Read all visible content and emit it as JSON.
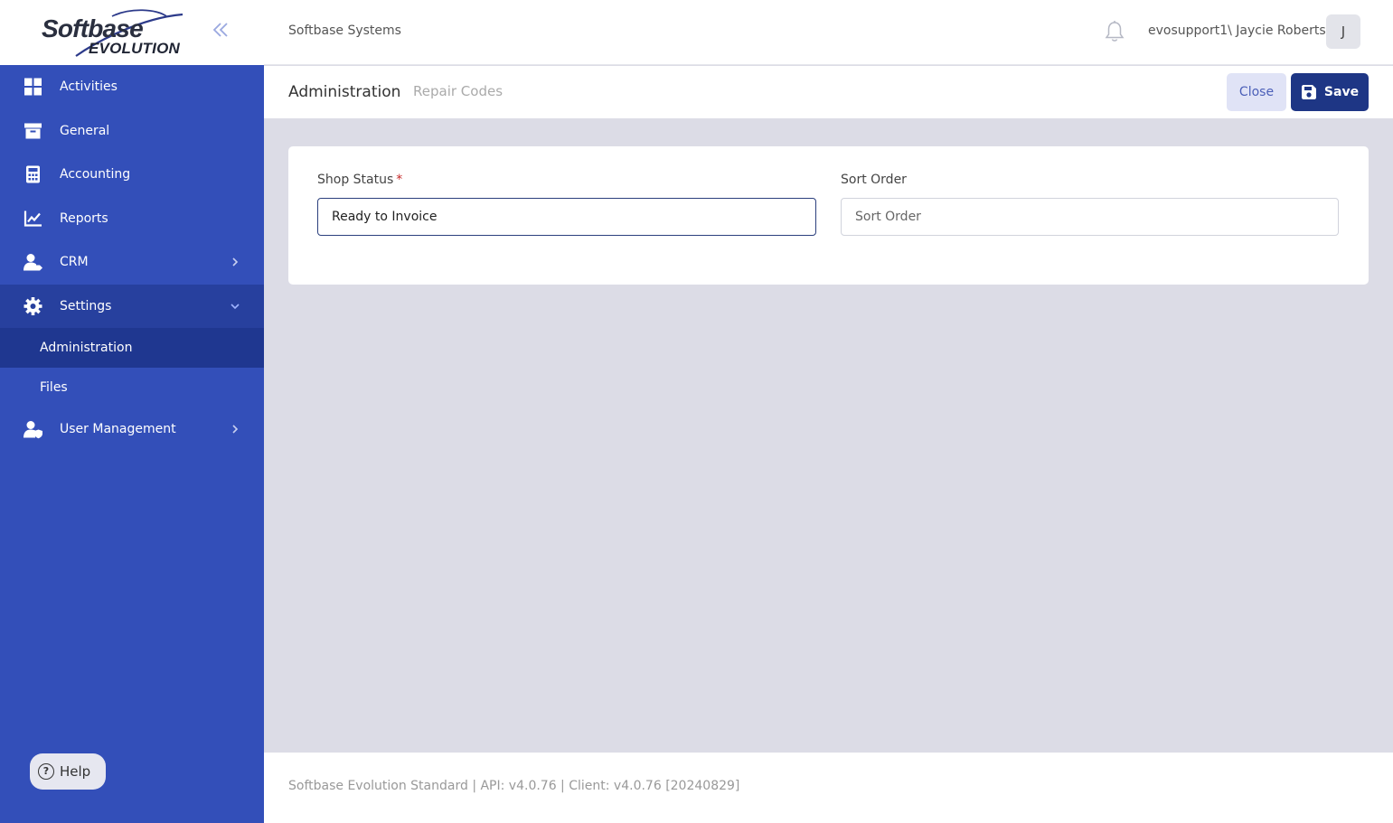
{
  "brand": {
    "logo_top": "Softbase",
    "logo_bottom": "EVOLUTION"
  },
  "sidebar": {
    "items": [
      {
        "label": "Activities",
        "icon": "grid-icon"
      },
      {
        "label": "General",
        "icon": "archive-box-icon"
      },
      {
        "label": "Accounting",
        "icon": "calculator-icon"
      },
      {
        "label": "Reports",
        "icon": "line-chart-icon"
      },
      {
        "label": "CRM",
        "icon": "user-tag-icon"
      },
      {
        "label": "Settings",
        "icon": "gear-icon",
        "expanded": true
      },
      {
        "label": "User Management",
        "icon": "user-shield-icon"
      }
    ],
    "settings_children": [
      {
        "label": "Administration",
        "active": true
      },
      {
        "label": "Files"
      }
    ],
    "help_label": "Help"
  },
  "header": {
    "company": "Softbase Systems",
    "user": "evosupport1\\ Jaycie Roberts",
    "avatar_initial": "J"
  },
  "subheader": {
    "title": "Administration",
    "breadcrumb": "Repair Codes",
    "close_label": "Close",
    "save_label": "Save"
  },
  "form": {
    "shop_status_label": "Shop Status",
    "required_mark": "*",
    "shop_status_value": "Ready to Invoice",
    "sort_order_label": "Sort Order",
    "sort_order_placeholder": "Sort Order",
    "sort_order_value": ""
  },
  "footer": {
    "text": "Softbase Evolution Standard | API: v4.0.76 | Client: v4.0.76 [20240829]"
  },
  "colors": {
    "sidebar": "#334fb9",
    "sidebar_active": "#1f3790",
    "save_button": "#1e3685",
    "close_button": "#e0e3f6",
    "content_bg": "#dcdce6"
  }
}
